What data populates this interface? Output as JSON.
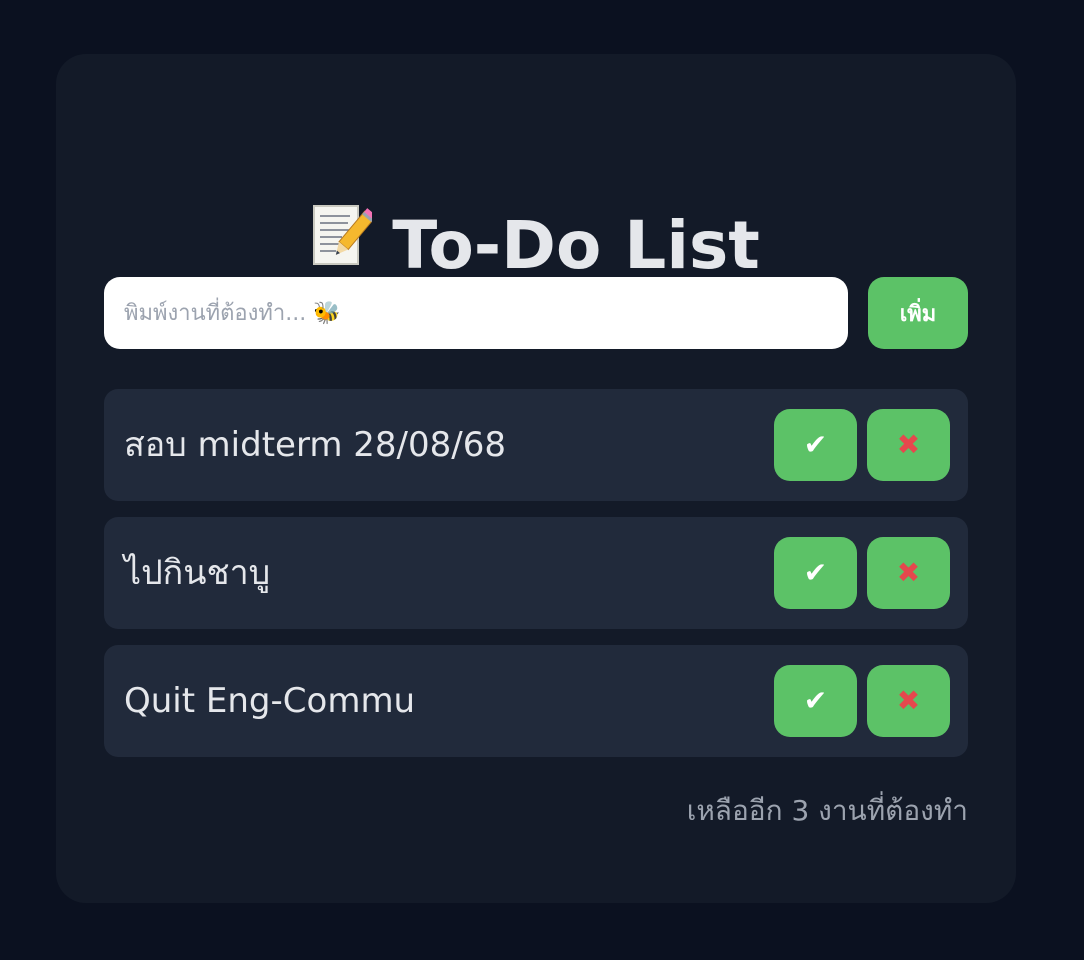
{
  "app": {
    "title": "To-Do List",
    "title_icon": "memo-icon"
  },
  "input": {
    "value": "",
    "placeholder": "พิมพ์งานที่ต้องทำ... 🐝"
  },
  "add_button": {
    "label": "เพิ่ม"
  },
  "tasks": [
    {
      "text": "สอบ midterm 28/08/68",
      "done_icon": "✔",
      "delete_icon": "✖"
    },
    {
      "text": "ไปกินชาบู",
      "done_icon": "✔",
      "delete_icon": "✖"
    },
    {
      "text": "Quit Eng-Commu",
      "done_icon": "✔",
      "delete_icon": "✖"
    }
  ],
  "footer": {
    "remaining_text": "เหลืออีก 3 งานที่ต้องทำ"
  },
  "colors": {
    "background": "#0b1120",
    "card": "#131a28",
    "task_bg": "#212a3b",
    "accent_green": "#5cc267",
    "delete_red": "#e5484d",
    "muted_text": "#9ca3af"
  }
}
